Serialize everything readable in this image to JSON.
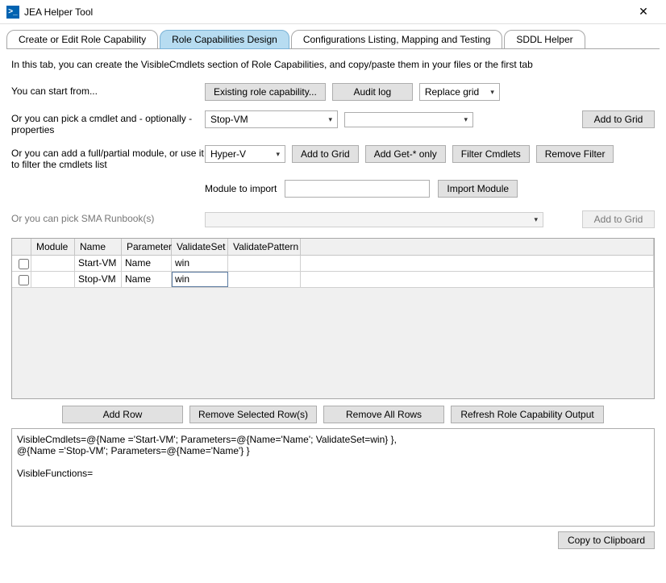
{
  "window": {
    "title": "JEA Helper Tool",
    "icon_glyph": ">_"
  },
  "tabs": [
    {
      "label": "Create or Edit Role Capability"
    },
    {
      "label": "Role Capabilities Design"
    },
    {
      "label": "Configurations Listing, Mapping and Testing"
    },
    {
      "label": "SDDL Helper"
    }
  ],
  "intro": "In this tab, you can create the VisibleCmdlets section of Role Capabilities, and copy/paste them in your files or the first tab",
  "start": {
    "label": "You can start from...",
    "existing_btn": "Existing role capability...",
    "audit_btn": "Audit log",
    "replace_grid": "Replace grid"
  },
  "cmdlet": {
    "label": "Or you can pick a cmdlet and - optionally - properties",
    "selected": "Stop-VM",
    "secondary_selected": "",
    "add_btn": "Add to Grid"
  },
  "module": {
    "label": "Or you can add a full/partial module, or use it to filter the cmdlets list",
    "selected": "Hyper-V",
    "add_btn": "Add to Grid",
    "add_get_btn": "Add Get-* only",
    "filter_btn": "Filter Cmdlets",
    "remove_filter_btn": "Remove Filter",
    "import_label": "Module to import",
    "import_value": "",
    "import_btn": "Import Module"
  },
  "sma": {
    "label": "Or you can pick SMA Runbook(s)",
    "add_btn": "Add to Grid"
  },
  "grid": {
    "headers": {
      "module": "Module",
      "name": "Name",
      "parameter": "Parameter",
      "validateSet": "ValidateSet",
      "validatePattern": "ValidatePattern"
    },
    "rows": [
      {
        "module": "",
        "name": "Start-VM",
        "parameter": "Name",
        "validateSet": "win",
        "validatePattern": ""
      },
      {
        "module": "",
        "name": "Stop-VM",
        "parameter": "Name",
        "validateSet": "win",
        "validatePattern": ""
      }
    ]
  },
  "grid_buttons": {
    "add": "Add Row",
    "remove_sel": "Remove Selected Row(s)",
    "remove_all": "Remove All Rows",
    "refresh": "Refresh Role Capability Output"
  },
  "output": "VisibleCmdlets=@{Name ='Start-VM'; Parameters=@{Name='Name'; ValidateSet=win} },\n@{Name ='Stop-VM'; Parameters=@{Name='Name'} }\n\nVisibleFunctions=",
  "footer": {
    "copy": "Copy to Clipboard"
  }
}
